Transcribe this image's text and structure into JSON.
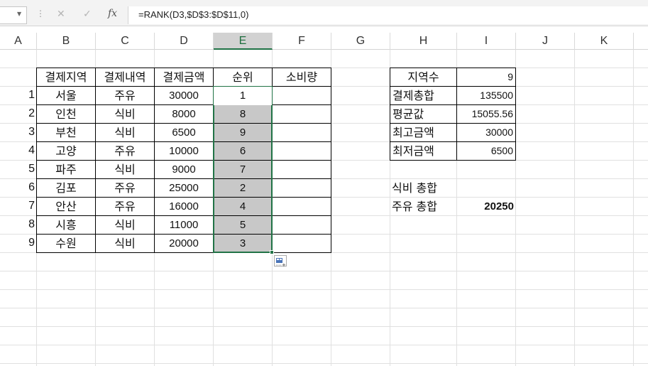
{
  "formula_bar": {
    "namebox": "",
    "formula": "=RANK(D3,$D$3:$D$11,0)",
    "fx": "fx",
    "cancel": "✕",
    "enter": "✓"
  },
  "columns": [
    "A",
    "B",
    "C",
    "D",
    "E",
    "F",
    "G",
    "H",
    "I",
    "J",
    "K"
  ],
  "table": {
    "headers": [
      "결제지역",
      "결제내역",
      "결제금액",
      "순위",
      "소비량"
    ],
    "rows": [
      {
        "n": "1",
        "region": "서울",
        "type": "주유",
        "amount": "30000",
        "rank": "1",
        "usage": ""
      },
      {
        "n": "2",
        "region": "인천",
        "type": "식비",
        "amount": "8000",
        "rank": "8",
        "usage": ""
      },
      {
        "n": "3",
        "region": "부천",
        "type": "식비",
        "amount": "6500",
        "rank": "9",
        "usage": ""
      },
      {
        "n": "4",
        "region": "고양",
        "type": "주유",
        "amount": "10000",
        "rank": "6",
        "usage": ""
      },
      {
        "n": "5",
        "region": "파주",
        "type": "식비",
        "amount": "9000",
        "rank": "7",
        "usage": ""
      },
      {
        "n": "6",
        "region": "김포",
        "type": "주유",
        "amount": "25000",
        "rank": "2",
        "usage": ""
      },
      {
        "n": "7",
        "region": "안산",
        "type": "주유",
        "amount": "16000",
        "rank": "4",
        "usage": ""
      },
      {
        "n": "8",
        "region": "시흥",
        "type": "식비",
        "amount": "11000",
        "rank": "5",
        "usage": ""
      },
      {
        "n": "9",
        "region": "수원",
        "type": "식비",
        "amount": "20000",
        "rank": "3",
        "usage": ""
      }
    ]
  },
  "summary": [
    {
      "label": "지역수",
      "value": "9"
    },
    {
      "label": "결제총합",
      "value": "135500"
    },
    {
      "label": "평균값",
      "value": "15055.56"
    },
    {
      "label": "최고금액",
      "value": "30000"
    },
    {
      "label": "최저금액",
      "value": "6500"
    }
  ],
  "totals": {
    "food_label": "식비 총합",
    "food_value": "",
    "fuel_label": "주유 총합",
    "fuel_value": "20250"
  },
  "colors": {
    "selection": "#217346",
    "rank_fill": "#c8c8c8"
  }
}
